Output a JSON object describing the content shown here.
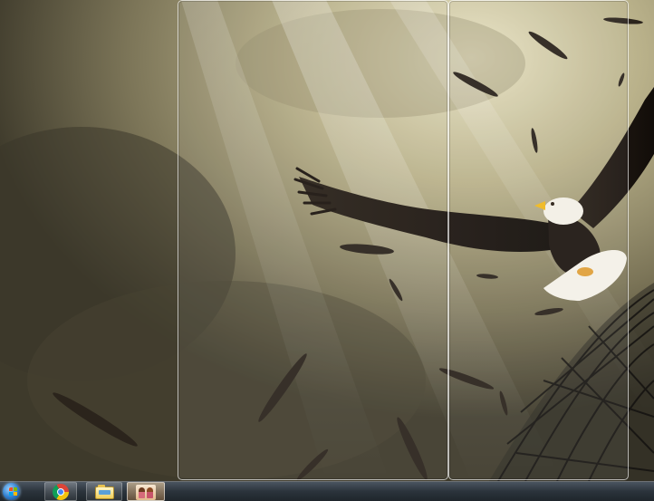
{
  "desktop": {
    "wallpaper_icon": "eagle-in-sky-wallpaper",
    "colors": {
      "sky_dark": "#3f3b2d",
      "sky_light": "#d9d3b3",
      "eagle_body": "#1f1812",
      "eagle_head": "#f3f0e6",
      "beak": "#f0b81e"
    }
  },
  "aero_peek": {
    "frames": [
      "window-outline-1",
      "window-outline-2"
    ]
  },
  "taskbar": {
    "start_icon": "windows-orb-icon",
    "items": [
      {
        "icon": "chrome-icon",
        "active": false
      },
      {
        "icon": "windows-explorer-icon",
        "active": false
      },
      {
        "icon": "photos-icon",
        "active": true
      }
    ],
    "colors": {
      "bar": "#2b333b",
      "active_item": "#e6a05a"
    }
  }
}
